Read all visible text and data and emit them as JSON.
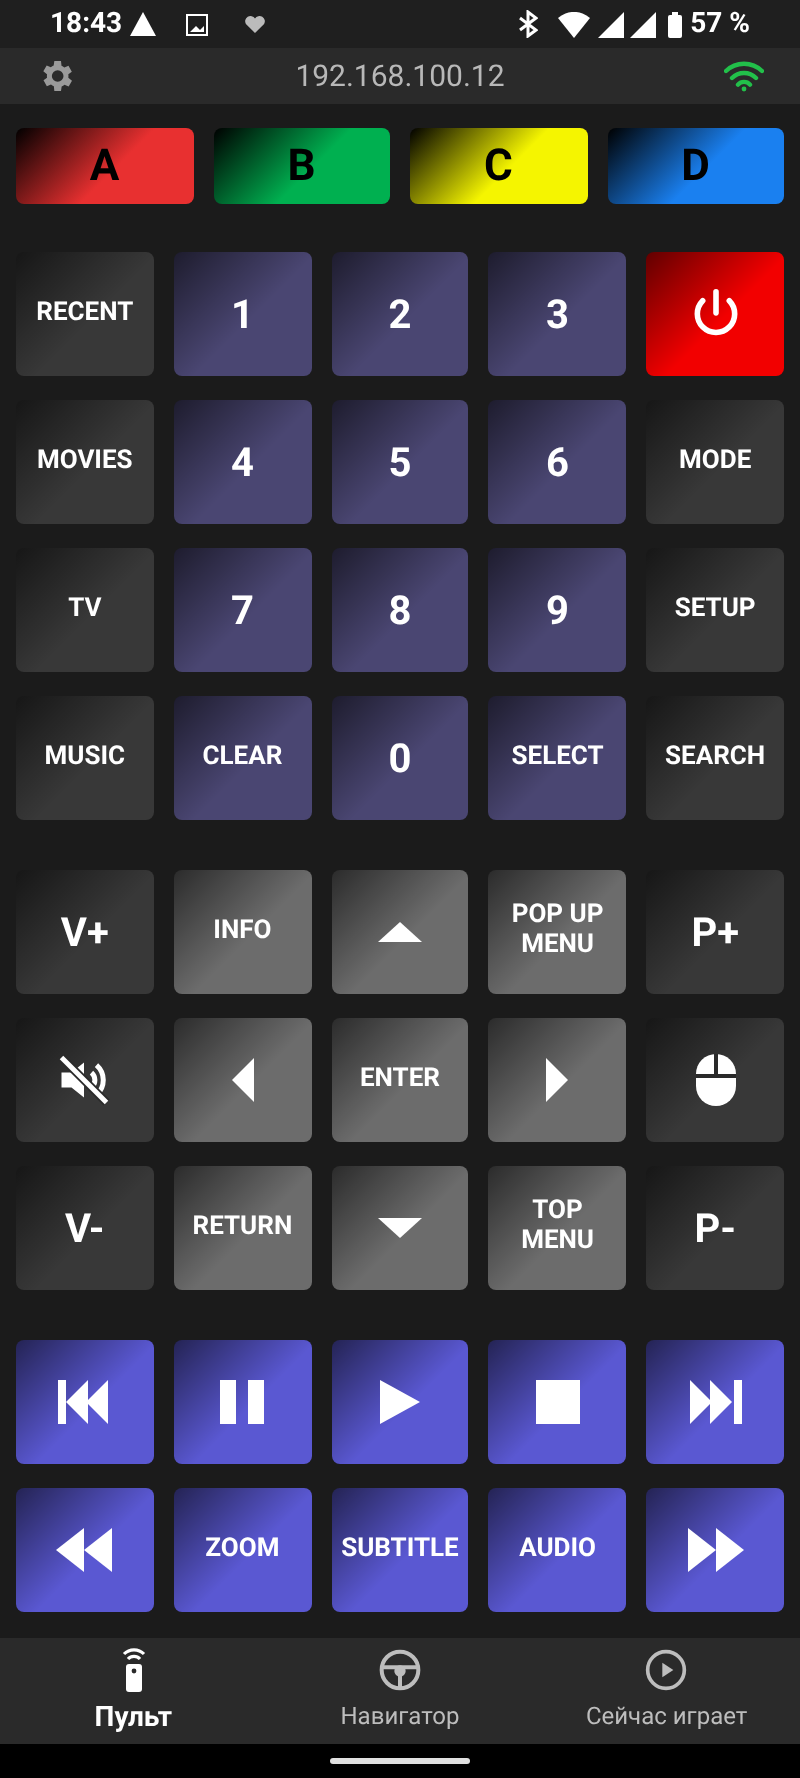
{
  "status_bar": {
    "time": "18:43",
    "battery": "57 %"
  },
  "top_bar": {
    "address": "192.168.100.12"
  },
  "color_buttons": [
    {
      "label": "A",
      "color": "#e83030"
    },
    {
      "label": "B",
      "color": "#00b050"
    },
    {
      "label": "C",
      "color": "#f5f500"
    },
    {
      "label": "D",
      "color": "#1a80f0"
    }
  ],
  "key_groups": [
    {
      "keys": [
        {
          "kind": "label",
          "color": "#383838",
          "label": "RECENT"
        },
        {
          "kind": "large",
          "color": "#4a4672",
          "label": "1"
        },
        {
          "kind": "large",
          "color": "#4a4672",
          "label": "2"
        },
        {
          "kind": "large",
          "color": "#4a4672",
          "label": "3"
        },
        {
          "kind": "power",
          "color": "#f20000"
        },
        {
          "kind": "label",
          "color": "#383838",
          "label": "MOVIES"
        },
        {
          "kind": "large",
          "color": "#4a4672",
          "label": "4"
        },
        {
          "kind": "large",
          "color": "#4a4672",
          "label": "5"
        },
        {
          "kind": "large",
          "color": "#4a4672",
          "label": "6"
        },
        {
          "kind": "label",
          "color": "#383838",
          "label": "MODE"
        },
        {
          "kind": "label",
          "color": "#383838",
          "label": "TV"
        },
        {
          "kind": "large",
          "color": "#4a4672",
          "label": "7"
        },
        {
          "kind": "large",
          "color": "#4a4672",
          "label": "8"
        },
        {
          "kind": "large",
          "color": "#4a4672",
          "label": "9"
        },
        {
          "kind": "label",
          "color": "#383838",
          "label": "SETUP"
        },
        {
          "kind": "label",
          "color": "#383838",
          "label": "MUSIC"
        },
        {
          "kind": "label",
          "color": "#4a4672",
          "label": "CLEAR"
        },
        {
          "kind": "large",
          "color": "#4a4672",
          "label": "0"
        },
        {
          "kind": "label",
          "color": "#4a4672",
          "label": "SELECT"
        },
        {
          "kind": "label",
          "color": "#383838",
          "label": "SEARCH"
        }
      ]
    },
    {
      "keys": [
        {
          "kind": "large",
          "color": "#383838",
          "label": "V+"
        },
        {
          "kind": "label",
          "color": "#6c6c6c",
          "label": "INFO"
        },
        {
          "kind": "up",
          "color": "#6c6c6c"
        },
        {
          "kind": "label",
          "color": "#6c6c6c",
          "label": "POP UP MENU"
        },
        {
          "kind": "large",
          "color": "#383838",
          "label": "P+"
        },
        {
          "kind": "mute",
          "color": "#383838"
        },
        {
          "kind": "left",
          "color": "#6c6c6c"
        },
        {
          "kind": "label",
          "color": "#6c6c6c",
          "label": "ENTER"
        },
        {
          "kind": "right",
          "color": "#6c6c6c"
        },
        {
          "kind": "mouse",
          "color": "#383838"
        },
        {
          "kind": "large",
          "color": "#383838",
          "label": "V-"
        },
        {
          "kind": "label",
          "color": "#6c6c6c",
          "label": "RETURN"
        },
        {
          "kind": "down",
          "color": "#6c6c6c"
        },
        {
          "kind": "label",
          "color": "#6c6c6c",
          "label": "TOP MENU"
        },
        {
          "kind": "large",
          "color": "#383838",
          "label": "P-"
        }
      ]
    },
    {
      "keys": [
        {
          "kind": "previous",
          "color": "#5a58d2"
        },
        {
          "kind": "pause",
          "color": "#5a58d2"
        },
        {
          "kind": "play",
          "color": "#5a58d2"
        },
        {
          "kind": "stop",
          "color": "#5a58d2"
        },
        {
          "kind": "next",
          "color": "#5a58d2"
        },
        {
          "kind": "rewind",
          "color": "#5a58d2"
        },
        {
          "kind": "label",
          "color": "#5a58d2",
          "label": "ZOOM"
        },
        {
          "kind": "label",
          "color": "#5a58d2",
          "label": "SUBTITLE"
        },
        {
          "kind": "label",
          "color": "#5a58d2",
          "label": "AUDIO"
        },
        {
          "kind": "forward",
          "color": "#5a58d2"
        }
      ]
    }
  ],
  "nav": [
    {
      "kind": "remote",
      "label": "Пульт",
      "selected": true
    },
    {
      "kind": "wheel",
      "label": "Навигатор",
      "selected": false
    },
    {
      "kind": "play",
      "label": "Сейчас играет",
      "selected": false
    }
  ]
}
